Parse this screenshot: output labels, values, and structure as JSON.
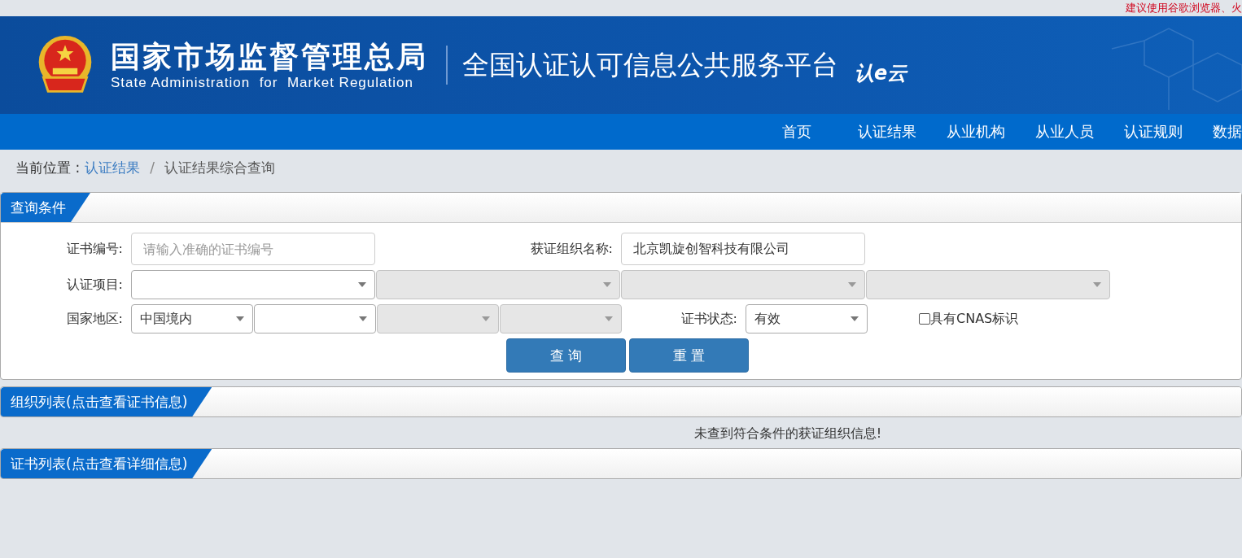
{
  "notice": "建议使用谷歌浏览器、火",
  "header": {
    "agency_cn": "国家市场监督管理总局",
    "agency_en": "State Administration  for  Market Regulation",
    "platform": "全国认证认可信息公共服务平台",
    "logo_text": "认e云"
  },
  "nav": [
    {
      "label": "首页",
      "selected": false
    },
    {
      "label": "认证结果",
      "selected": false
    },
    {
      "label": "从业机构",
      "selected": false
    },
    {
      "label": "从业人员",
      "selected": false
    },
    {
      "label": "认证规则",
      "selected": false
    },
    {
      "label": "数据",
      "selected": false
    }
  ],
  "breadcrumb": {
    "prefix": "当前位置 :",
    "link": "认证结果",
    "separator": "/",
    "current": "认证结果综合查询"
  },
  "query": {
    "title": "查询条件",
    "cert_no": {
      "label": "证书编号:",
      "placeholder": "请输入准确的证书编号"
    },
    "org_name": {
      "label": "获证组织名称:",
      "value": "北京凯旋创智科技有限公司"
    },
    "project": {
      "label": "认证项目:",
      "selects": [
        {
          "disabled": false
        },
        {
          "disabled": true
        },
        {
          "disabled": true
        },
        {
          "disabled": true
        }
      ]
    },
    "region": {
      "label": "国家地区:",
      "selects": [
        {
          "value": "中国境内",
          "disabled": false
        },
        {
          "disabled": false
        },
        {
          "disabled": true
        },
        {
          "disabled": true
        }
      ]
    },
    "status": {
      "label": "证书状态:",
      "value": "有效",
      "disabled": false
    },
    "cnas": {
      "label": "具有CNAS标识",
      "checked": false
    },
    "buttons": [
      "查 询",
      "重 置"
    ]
  },
  "org_list": {
    "title": "组织列表(点击查看证书信息)",
    "message": "未查到符合条件的获证组织信息!"
  },
  "cert_list": {
    "title": "证书列表(点击查看详细信息)"
  }
}
